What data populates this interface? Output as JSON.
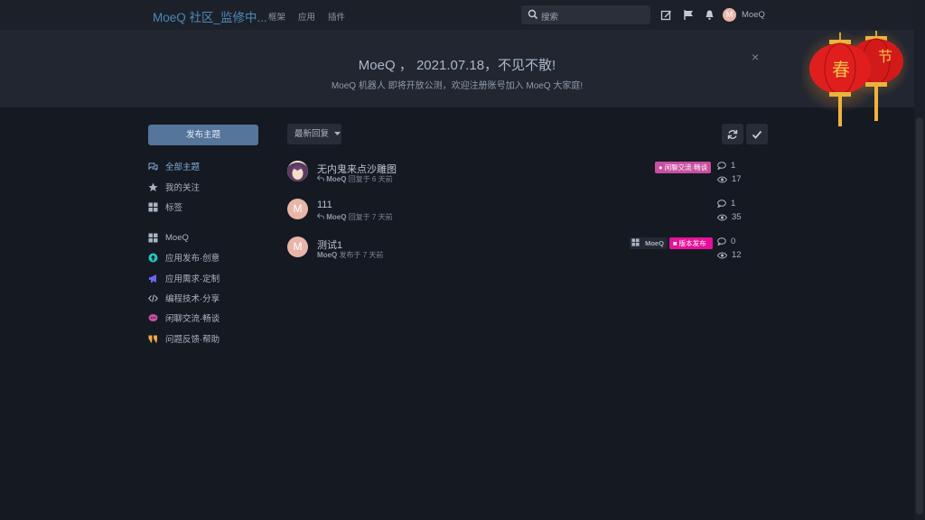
{
  "colors": {
    "accent": "#4b8ab8",
    "background": "#151922",
    "tag_chat": "#c84fa0",
    "tag_release": "#e6109b"
  },
  "header": {
    "brand": "MoeQ 社区_监修中...",
    "nav": [
      {
        "label": "框架"
      },
      {
        "label": "应用"
      },
      {
        "label": "插件"
      }
    ],
    "search_placeholder": "搜索",
    "username": "MoeQ",
    "avatar_letter": "M"
  },
  "hero": {
    "title": "MoeQ ， 2021.07.18，不见不散!",
    "subtitle": "MoeQ 机器人 即将开放公测，欢迎注册账号加入 MoeQ 大家庭!",
    "close": "×"
  },
  "sidebar": {
    "new_button": "发布主题",
    "items": [
      {
        "label": "全部主题",
        "icon": "comments-icon"
      },
      {
        "label": "我的关注",
        "icon": "star-icon"
      },
      {
        "label": "标签",
        "icon": "grid-icon"
      },
      {
        "label": "MoeQ",
        "icon": "grid-icon"
      },
      {
        "label": "应用发布·创意",
        "icon": "upload-circle-icon"
      },
      {
        "label": "应用需求·定制",
        "icon": "megaphone-icon"
      },
      {
        "label": "编程技术·分享",
        "icon": "code-icon"
      },
      {
        "label": "闲聊交流·畅谈",
        "icon": "chat-bubble-icon"
      },
      {
        "label": "问题反馈·帮助",
        "icon": "quote-icon"
      }
    ]
  },
  "toolbar": {
    "sort_label": "最新回复"
  },
  "discussions": [
    {
      "title": "无内鬼来点沙雕图",
      "user": "MoeQ",
      "action": "回复于 6 天前",
      "tags": [
        "闲聊交流·畅谈"
      ],
      "replies": "1",
      "views": "17",
      "avatar_letter": ""
    },
    {
      "title": "111",
      "user": "MoeQ",
      "action": "回复于 7 天前",
      "tags": [],
      "replies": "1",
      "views": "35",
      "avatar_letter": "M"
    },
    {
      "title": "测试1",
      "user": "MoeQ",
      "action": "发布于 7 天前",
      "tags": [
        "MoeQ",
        "版本发布"
      ],
      "replies": "0",
      "views": "12",
      "avatar_letter": "M"
    }
  ],
  "decoration": {
    "lantern_left": "春",
    "lantern_right": "节"
  }
}
